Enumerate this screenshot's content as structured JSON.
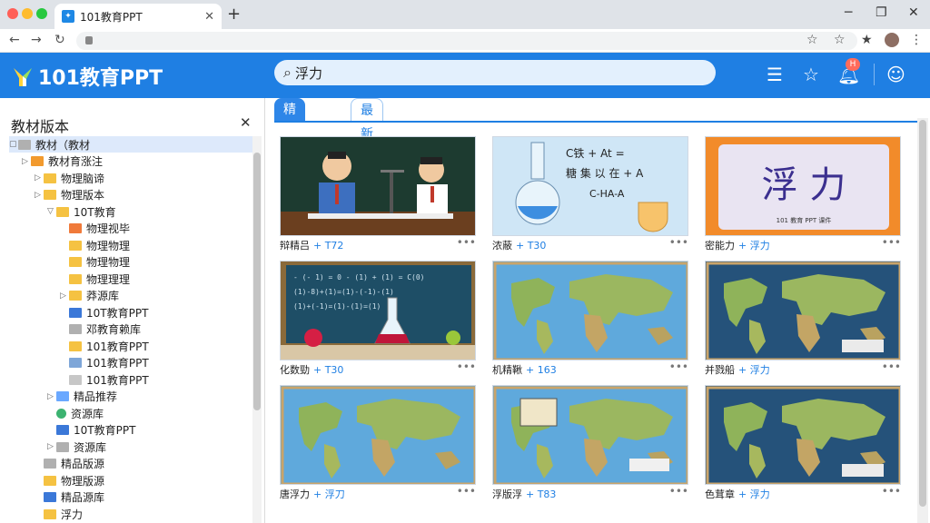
{
  "browser": {
    "tab_title": "101教育PPT",
    "tab_close": "✕",
    "new_tab": "+",
    "minimize": "─",
    "restore": "❐",
    "close": "✕",
    "back": "←",
    "forward": "→",
    "reload": "↻"
  },
  "app": {
    "logo_text": "101教育PPT",
    "search_value": "浮力",
    "notification_count": "H",
    "colors": {
      "brand": "#1f7fe3",
      "badge": "#ff6b5b"
    }
  },
  "sidebar": {
    "title": "教材版本",
    "close": "✕",
    "items": [
      {
        "label": "教材（教材",
        "depth": 0,
        "icon": "gray-folder-icon",
        "toggle": "▢",
        "selected": true
      },
      {
        "label": "教材育涨注",
        "depth": 1,
        "icon": "orange-folder-icon",
        "toggle": "▷"
      },
      {
        "label": "物理脑谛",
        "depth": 2,
        "icon": "yellow-folder-icon",
        "toggle": "▷"
      },
      {
        "label": "物理版本",
        "depth": 2,
        "icon": "yellow-folder-icon",
        "toggle": "▷"
      },
      {
        "label": "10T教育",
        "depth": 3,
        "icon": "yellow-folder-icon",
        "toggle": "▽"
      },
      {
        "label": "物理视毕",
        "depth": 4,
        "icon": "orange-doc-icon",
        "toggle": ""
      },
      {
        "label": "物理物理",
        "depth": 4,
        "icon": "yellow-folder-icon",
        "toggle": ""
      },
      {
        "label": "物理物理",
        "depth": 4,
        "icon": "yellow-folder-icon",
        "toggle": ""
      },
      {
        "label": "物理理理",
        "depth": 4,
        "icon": "yellow-folder-icon",
        "toggle": ""
      },
      {
        "label": "莽源库",
        "depth": 4,
        "icon": "yellow-folder-icon",
        "toggle": "▷"
      },
      {
        "label": "10T教育PPT",
        "depth": 4,
        "icon": "blue-list-icon",
        "toggle": ""
      },
      {
        "label": "邓教育赖库",
        "depth": 4,
        "icon": "gray-folder-icon",
        "toggle": ""
      },
      {
        "label": "101教育PPT",
        "depth": 4,
        "icon": "yellow-folder-icon",
        "toggle": ""
      },
      {
        "label": "101教育PPT",
        "depth": 4,
        "icon": "search-doc-icon",
        "toggle": ""
      },
      {
        "label": "101教育PPT",
        "depth": 4,
        "icon": "gray-doc-icon",
        "toggle": ""
      },
      {
        "label": "精品推荐",
        "depth": 3,
        "icon": "diamond-icon",
        "toggle": "▷"
      },
      {
        "label": "资源库",
        "depth": 3,
        "icon": "green-circle-icon",
        "toggle": ""
      },
      {
        "label": "10T教育PPT",
        "depth": 3,
        "icon": "blue-list-icon",
        "toggle": ""
      },
      {
        "label": "资源库",
        "depth": 3,
        "icon": "gray-folder-icon",
        "toggle": "▷"
      },
      {
        "label": "精品版源",
        "depth": 2,
        "icon": "gray-folder-icon",
        "toggle": ""
      },
      {
        "label": "物理版源",
        "depth": 2,
        "icon": "yellow-folder-icon",
        "toggle": ""
      },
      {
        "label": "精品源库",
        "depth": 2,
        "icon": "blue-list-icon",
        "toggle": ""
      },
      {
        "label": "浮力",
        "depth": 2,
        "icon": "yellow-folder-icon",
        "toggle": ""
      }
    ]
  },
  "main": {
    "tabs": [
      {
        "label": "精品推荐",
        "active": false
      },
      {
        "label": "最新上传",
        "active": true
      }
    ],
    "cards": [
      {
        "title": "辩精吕",
        "meta": "+ T72",
        "more": "•••",
        "thumb": "classroom"
      },
      {
        "title": "浓蔽",
        "meta": "+ T30",
        "more": "•••",
        "thumb": "flask"
      },
      {
        "title": "密能力",
        "meta": "+ 浮力",
        "more": "•••",
        "thumb": "title"
      },
      {
        "title": "化数勁",
        "meta": "+ T30",
        "more": "•••",
        "thumb": "chemistry"
      },
      {
        "title": "机精鞦",
        "meta": "+ 163",
        "more": "•••",
        "thumb": "map"
      },
      {
        "title": "并戮船",
        "meta": "+ 浮力",
        "more": "•••",
        "thumb": "map-dark"
      },
      {
        "title": "唐浮力",
        "meta": "+ 浮刀",
        "more": "•••",
        "thumb": "map"
      },
      {
        "title": "浮版浮",
        "meta": "+ T83",
        "more": "•••",
        "thumb": "map-label"
      },
      {
        "title": "色茸章",
        "meta": "+ 浮力",
        "more": "•••",
        "thumb": "map-dark"
      }
    ],
    "thumb_text": {
      "formula1": "C铁 + At =",
      "formula2": "糖 集  以  在 + A",
      "formula3": "C-HA-A",
      "big_title": "浮 力",
      "small_title": "101 教育 PPT 课件",
      "board_eq": "- (- 1) = 0 - (1) + (1) = C(0)"
    }
  }
}
